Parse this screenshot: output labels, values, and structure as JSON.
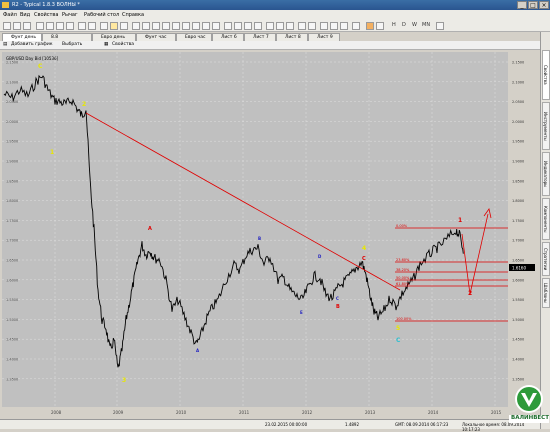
{
  "title": "R2 - Typical 1.8.3 ВОЛНЫ *",
  "menu": [
    "Файл",
    "Вид",
    "Свойства",
    "Рычаг",
    "Рабочий стол",
    "Справка"
  ],
  "symbol": "USD/CHF",
  "tabs": [
    "Фунт день",
    "8.8 Альтернатива",
    "Евро день",
    "Фунт час",
    "Евро час",
    "Лист 6",
    "Лист 7",
    "Лист 8",
    "Лист 9"
  ],
  "subbar": {
    "add_chart": "Добавить график",
    "select": "Выбрать",
    "properties": "Свойства"
  },
  "series_label": "GBP/USD Day Bid [10536]",
  "side_tabs": [
    "Свойства",
    "Инструменты",
    "Индикаторы",
    "Компоненты",
    "Стратегии",
    "Шаблоны"
  ],
  "fib_labels": [
    "0.00%",
    "23.60%",
    "38.20%",
    "50.00%",
    "61.80%",
    "100.00%"
  ],
  "price_marker": "1.6160",
  "status": {
    "time": "23.02.2015 00:00:00",
    "price": "1.4892",
    "gmt": "GMT: 08.09.2014 06:17:23",
    "local": "Локальное время: 08.09.2014 10:17:23"
  },
  "logo_text": "ВАЛИНВЕСТ",
  "colors": {
    "chart_bg": "#c0c0c0",
    "trend": "#e00000",
    "wave_yellow": "#e8e800",
    "wave_red": "#e00000",
    "wave_blue": "#2020c0",
    "wave_cyan": "#30c0d0"
  },
  "chart_data": {
    "type": "line",
    "title": "",
    "x_ticks": [
      "2008",
      "2009",
      "2010",
      "2011",
      "2012",
      "2013",
      "2014",
      "2015"
    ],
    "y_ticks": [
      "2.1500",
      "2.1000",
      "2.0500",
      "2.0000",
      "1.9500",
      "1.9000",
      "1.8500",
      "1.8000",
      "1.7500",
      "1.7000",
      "1.6500",
      "1.6000",
      "1.5500",
      "1.5000",
      "1.4500",
      "1.4000",
      "1.3500"
    ],
    "wave_labels": [
      {
        "text": "C",
        "color": "yellow"
      },
      {
        "text": "1",
        "color": "yellow"
      },
      {
        "text": "2",
        "color": "yellow"
      },
      {
        "text": "3",
        "color": "yellow"
      },
      {
        "text": "A",
        "color": "red"
      },
      {
        "text": "B",
        "color": "blue"
      },
      {
        "text": "A",
        "color": "blue"
      },
      {
        "text": "D",
        "color": "blue"
      },
      {
        "text": "C",
        "color": "blue"
      },
      {
        "text": "E",
        "color": "blue"
      },
      {
        "text": "B",
        "color": "red"
      },
      {
        "text": "4",
        "color": "yellow"
      },
      {
        "text": "C",
        "color": "red"
      },
      {
        "text": "5",
        "color": "yellow"
      },
      {
        "text": "C",
        "color": "cyan"
      },
      {
        "text": "1",
        "color": "red"
      },
      {
        "text": "2",
        "color": "red"
      }
    ]
  }
}
